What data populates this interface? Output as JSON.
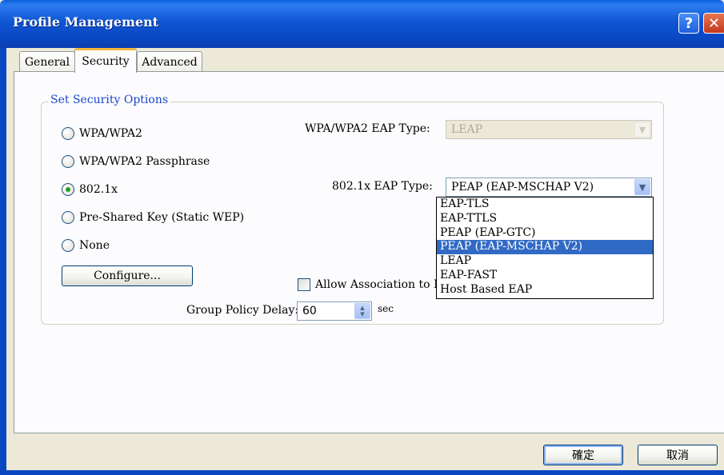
{
  "window": {
    "title": "Profile Management",
    "help_icon": "question-mark",
    "close_icon": "x-mark"
  },
  "tabs": [
    {
      "label": "General",
      "active": false
    },
    {
      "label": "Security",
      "active": true
    },
    {
      "label": "Advanced",
      "active": false
    }
  ],
  "security": {
    "group_title": "Set Security Options",
    "options": [
      {
        "label": "WPA/WPA2",
        "checked": false
      },
      {
        "label": "WPA/WPA2 Passphrase",
        "checked": false
      },
      {
        "label": "802.1x",
        "checked": true
      },
      {
        "label": "Pre-Shared Key (Static WEP)",
        "checked": false
      },
      {
        "label": "None",
        "checked": false
      }
    ],
    "configure_label": "Configure...",
    "wpa_eap_label": "WPA/WPA2 EAP Type:",
    "wpa_eap_value": "LEAP",
    "eap_8021x_label": "802.1x EAP Type:",
    "eap_8021x_value": "PEAP (EAP-MSCHAP V2)",
    "eap_8021x_options": [
      "EAP-TLS",
      "EAP-TTLS",
      "PEAP (EAP-GTC)",
      "PEAP (EAP-MSCHAP V2)",
      "LEAP",
      "EAP-FAST",
      "Host Based EAP"
    ],
    "eap_8021x_selected_index": 3,
    "allow_association_label": "Allow Association to M",
    "group_policy_label": "Group Policy Delay:",
    "group_policy_value": "60",
    "group_policy_unit": "sec"
  },
  "footer": {
    "ok_label": "確定",
    "cancel_label": "取消"
  },
  "colors": {
    "titlebar": "#0a47c2",
    "active_tab_accent": "#f6b73c",
    "group_title": "#1a46c8",
    "selection": "#316ac5",
    "radio_dot": "#21a121"
  }
}
